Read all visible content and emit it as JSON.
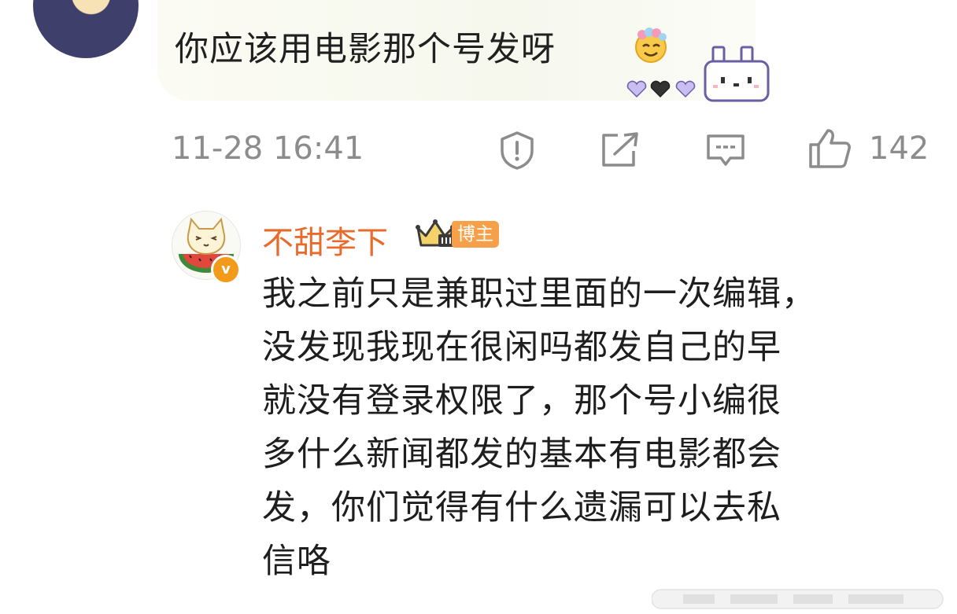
{
  "comment": {
    "text": "你应该用电影那个号发呀",
    "timestamp": "11-28 16:41",
    "like_count": "142"
  },
  "reply": {
    "username": "不甜李下",
    "badge_label": "博主",
    "verified_mark": "v",
    "lines": [
      "我之前只是兼职过里面的一次编辑，",
      "没发现我现在很闲吗都发自己的早",
      "就没有登录权限了，那个号小编很",
      "多什么新闻都发的基本有电影都会",
      "发，你们觉得有什么遗漏可以去私",
      "信咯"
    ]
  },
  "icons": [
    "report-icon",
    "repost-icon",
    "comment-icon",
    "like-icon"
  ],
  "colors": {
    "meta_gray": "#8c8c8c",
    "username_orange": "#e86b2c",
    "badge_orange": "#f6a04a"
  }
}
